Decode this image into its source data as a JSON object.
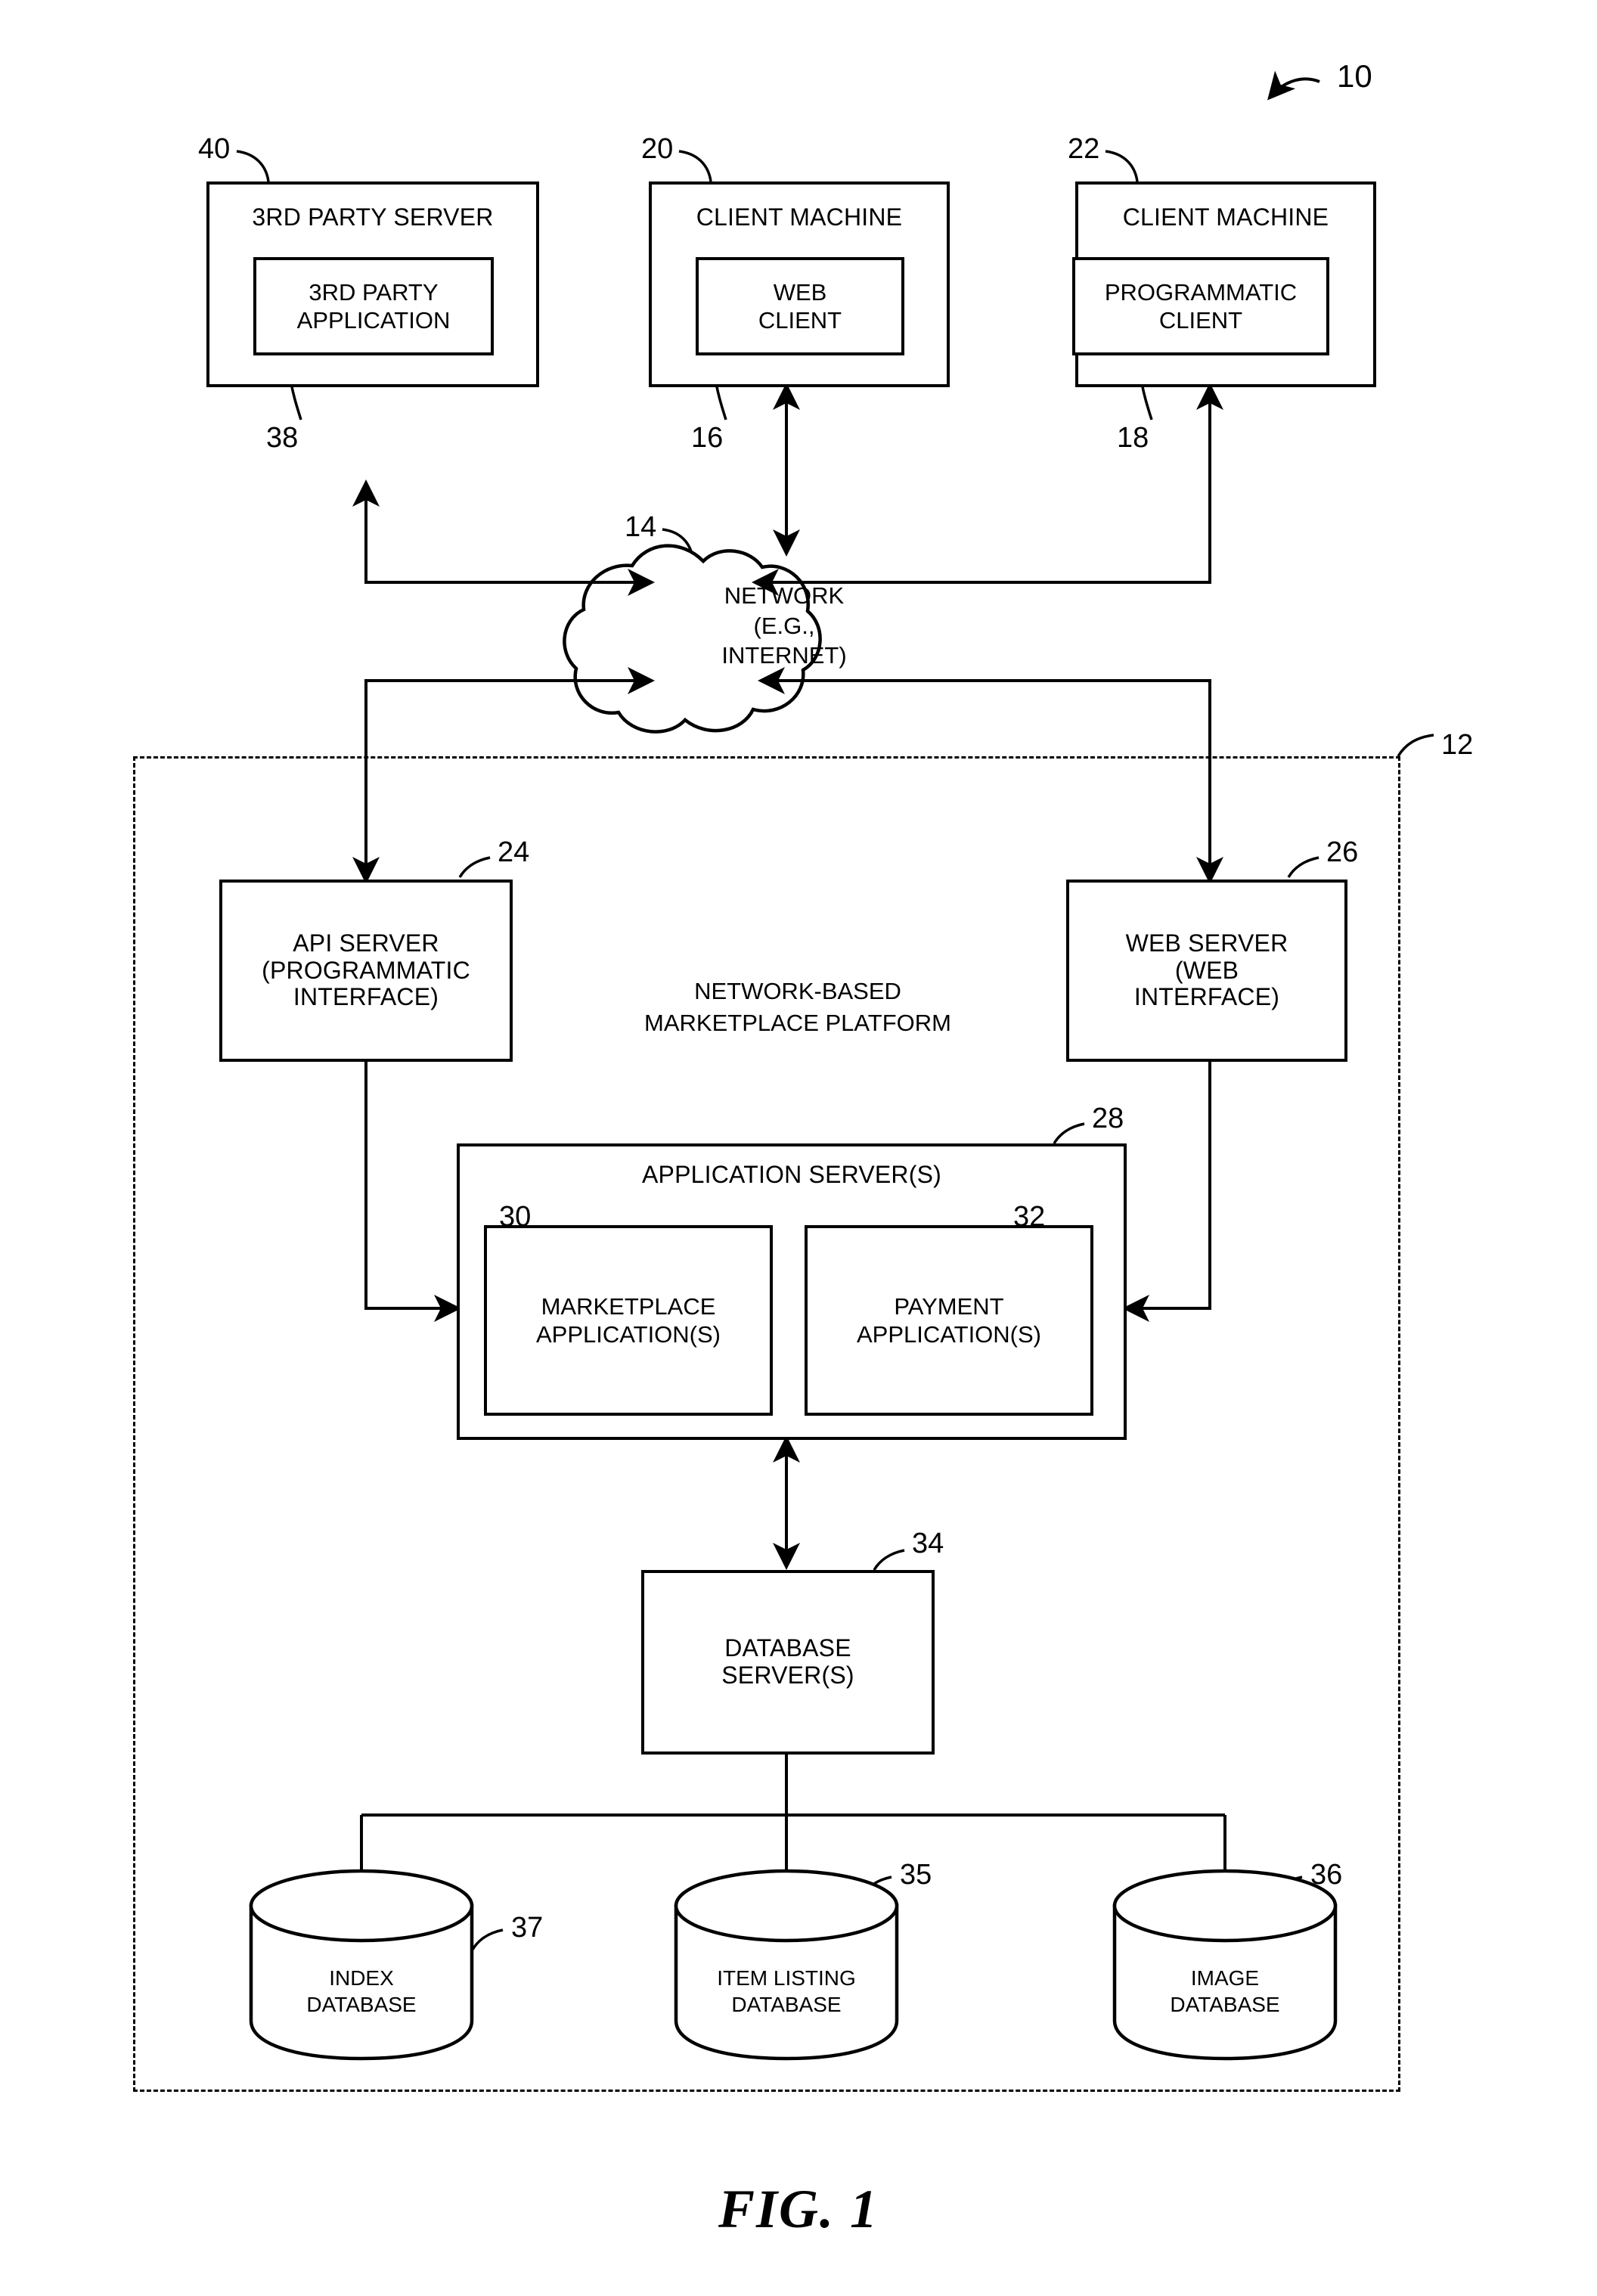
{
  "figure": {
    "caption": "FIG. 1",
    "system_ref": "10"
  },
  "nodes": {
    "third_party_server": {
      "ref": "40",
      "title": "3RD PARTY SERVER",
      "inner": {
        "ref": "38",
        "label": "3RD PARTY\nAPPLICATION"
      }
    },
    "client_machine_web": {
      "ref": "20",
      "title": "CLIENT MACHINE",
      "inner": {
        "ref": "16",
        "label": "WEB\nCLIENT"
      }
    },
    "client_machine_programmatic": {
      "ref": "22",
      "title": "CLIENT MACHINE",
      "inner": {
        "ref": "18",
        "label": "PROGRAMMATIC\nCLIENT"
      }
    },
    "network": {
      "ref": "14",
      "label": "NETWORK\n(E.G.,\nINTERNET)"
    },
    "platform": {
      "ref": "12",
      "label": "NETWORK-BASED\nMARKETPLACE PLATFORM"
    },
    "api_server": {
      "ref": "24",
      "label": "API SERVER\n(PROGRAMMATIC\nINTERFACE)"
    },
    "web_server": {
      "ref": "26",
      "label": "WEB SERVER\n(WEB\nINTERFACE)"
    },
    "application_server": {
      "ref": "28",
      "title": "APPLICATION SERVER(S)",
      "children": [
        {
          "ref": "30",
          "label": "MARKETPLACE\nAPPLICATION(S)"
        },
        {
          "ref": "32",
          "label": "PAYMENT\nAPPLICATION(S)"
        }
      ]
    },
    "database_server": {
      "ref": "34",
      "label": "DATABASE\nSERVER(S)"
    },
    "databases": [
      {
        "ref": "37",
        "label": "INDEX\nDATABASE"
      },
      {
        "ref": "35",
        "label": "ITEM LISTING\nDATABASE"
      },
      {
        "ref": "36",
        "label": "IMAGE\nDATABASE"
      }
    ]
  },
  "colors": {
    "ink": "#000000",
    "paper": "#ffffff"
  }
}
